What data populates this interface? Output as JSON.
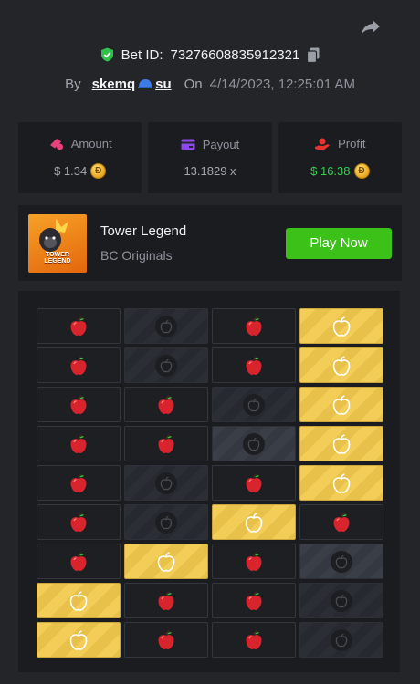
{
  "header": {
    "bet_label": "Bet ID:",
    "bet_id": "73276608835912321",
    "by_label": "By",
    "username": "skemq",
    "username_suffix": "su",
    "on_label": "On",
    "date": "4/14/2023, 12:25:01 AM"
  },
  "stats": {
    "amount_label": "Amount",
    "amount_value": "$ 1.34",
    "payout_label": "Payout",
    "payout_value": "13.1829 x",
    "profit_label": "Profit",
    "profit_value": "$ 16.38",
    "coin_symbol": "Đ"
  },
  "game": {
    "title": "Tower Legend",
    "provider": "BC Originals",
    "play_label": "Play Now",
    "thumb_text_1": "TOWER",
    "thumb_text_2": "LEGEND"
  },
  "board": {
    "rows": [
      [
        "apple",
        "dark",
        "apple",
        "gold"
      ],
      [
        "apple",
        "dark",
        "apple",
        "gold"
      ],
      [
        "apple",
        "apple",
        "dark",
        "gold"
      ],
      [
        "apple",
        "apple",
        "dark-lit",
        "gold"
      ],
      [
        "apple",
        "dark",
        "apple",
        "gold"
      ],
      [
        "apple",
        "dark",
        "gold",
        "apple"
      ],
      [
        "apple",
        "gold",
        "apple",
        "dark-lit"
      ],
      [
        "gold",
        "apple",
        "apple",
        "dark"
      ],
      [
        "gold",
        "apple",
        "apple",
        "dark"
      ]
    ]
  },
  "colors": {
    "accent_green": "#3bc117",
    "profit_green": "#33d24e",
    "gold_tile": "#f2ce58",
    "apple_red": "#d8242c"
  },
  "icons": {
    "share": "share-icon",
    "verified": "shield-check-icon",
    "copy": "copy-icon",
    "amount": "coins-icon",
    "payout": "wallet-icon",
    "profit": "hand-money-icon"
  }
}
